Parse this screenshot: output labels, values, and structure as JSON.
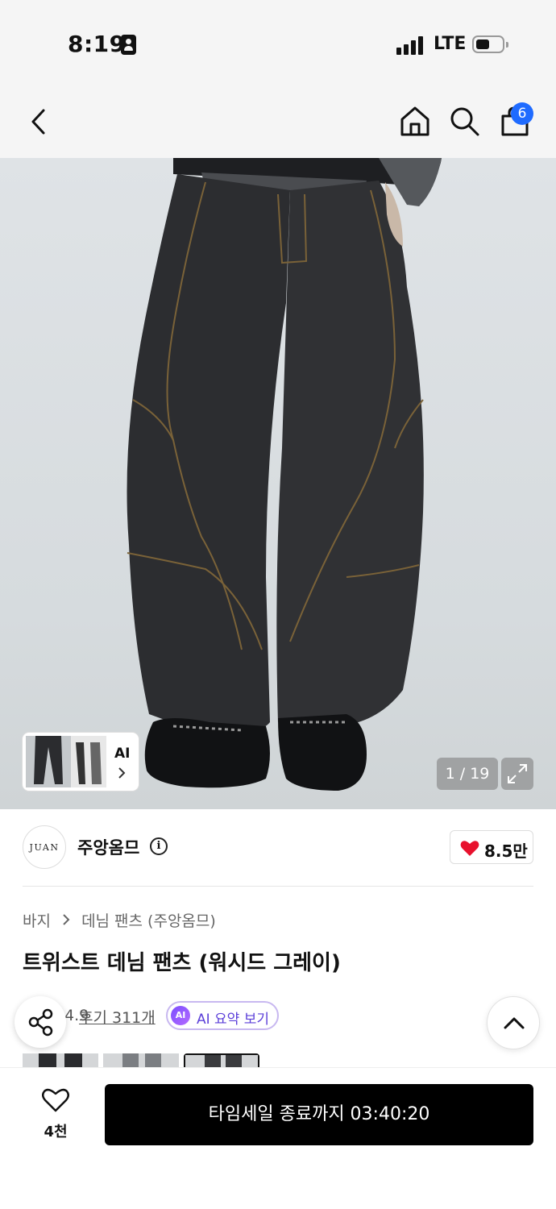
{
  "status_bar": {
    "time": "8:19",
    "network": "LTE"
  },
  "nav": {
    "cart_count": "6",
    "icons": [
      "back-icon",
      "home-icon",
      "search-icon",
      "cart-icon"
    ]
  },
  "hero": {
    "image_counter": "1 / 19",
    "ai_thumb_label": "AI",
    "colors": {
      "background": "#d9dde0",
      "denim": "#2c2d30",
      "stitching": "#8a6a3a"
    }
  },
  "brand": {
    "logo_text": "JUAN",
    "name": "주앙옴므",
    "likes": "8.5만"
  },
  "breadcrumb": {
    "items": [
      "바지",
      "데님 팬츠 (주앙옴므)"
    ]
  },
  "product": {
    "title": "트위스트 데님 팬츠 (워시드 그레이)",
    "rating": "4.9",
    "reviews": "후기 311개",
    "ai_badge": "AI",
    "ai_summary": "AI 요약 보기"
  },
  "bottom_bar": {
    "wish_count": "4천",
    "cta_label": "타임세일 종료까지 03:40:20",
    "accent": "#000000"
  }
}
